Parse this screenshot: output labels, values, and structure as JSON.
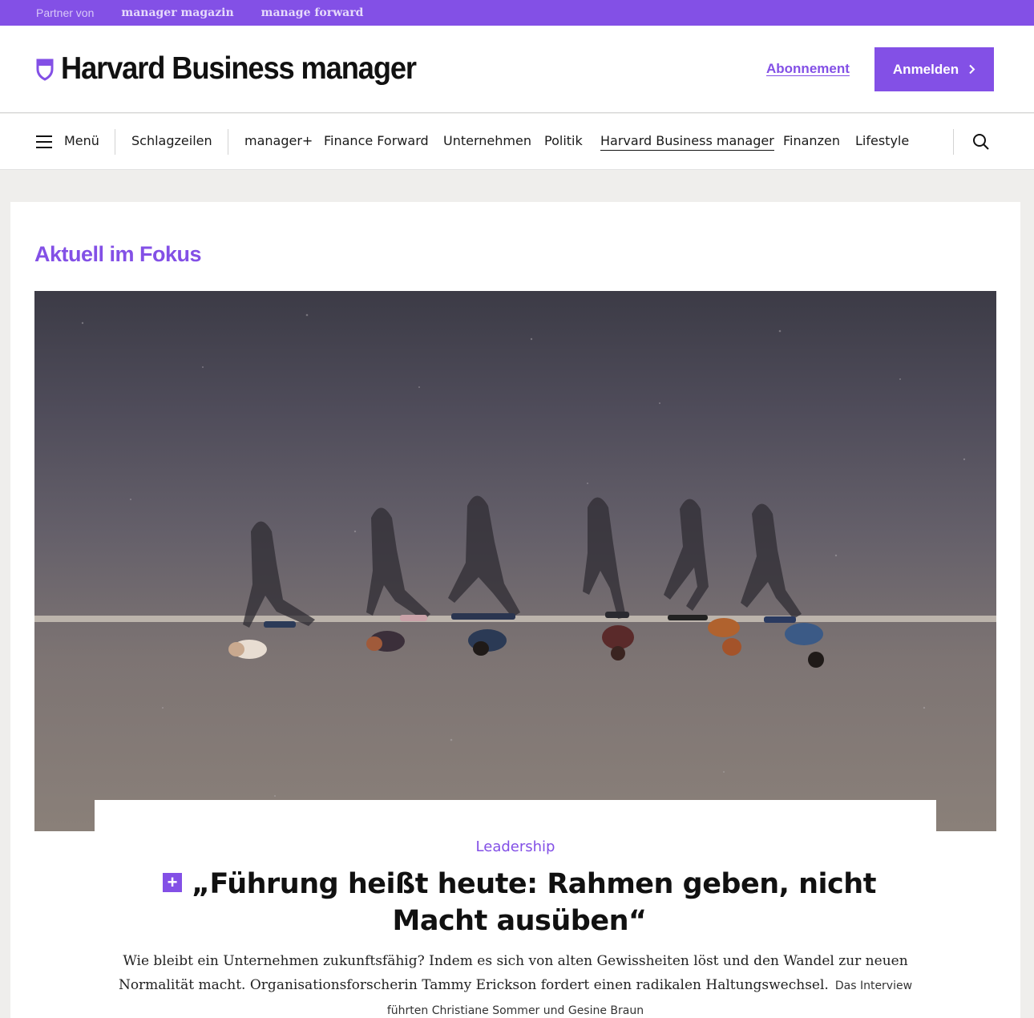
{
  "topbar": {
    "partner_label": "Partner von",
    "links": [
      "manager magazin",
      "manage forward"
    ]
  },
  "header": {
    "brand": "Harvard Business manager",
    "subscription_label": "Abonnement",
    "login_label": "Anmelden",
    "login_icon": "chevron-right-icon",
    "brand_color": "#8350e6"
  },
  "nav": {
    "menu_label": "Menü",
    "headlines_label": "Schlagzeilen",
    "items": [
      "manager+",
      "Finance Forward",
      "Unternehmen",
      "Politik",
      "Harvard Business manager",
      "Finanzen",
      "Lifestyle"
    ],
    "active_item": "Harvard Business manager",
    "search_icon": "search-icon"
  },
  "focus": {
    "section_title": "Aktuell im Fokus",
    "article": {
      "category": "Leadership",
      "premium_badge": "+",
      "headline": "„Führung heißt heute: Rahmen geben, nicht Macht ausüben“",
      "teaser": "Wie bleibt ein Unternehmen zukunftsfähig? Indem es sich von alten Gewissheiten löst und den Wandel zur neuen Normalität macht. Organisationsforscherin Tammy Erickson fordert einen radikalen Haltungswechsel.",
      "author": "Das Interview führten Christiane Sommer und Gesine Braun"
    }
  }
}
